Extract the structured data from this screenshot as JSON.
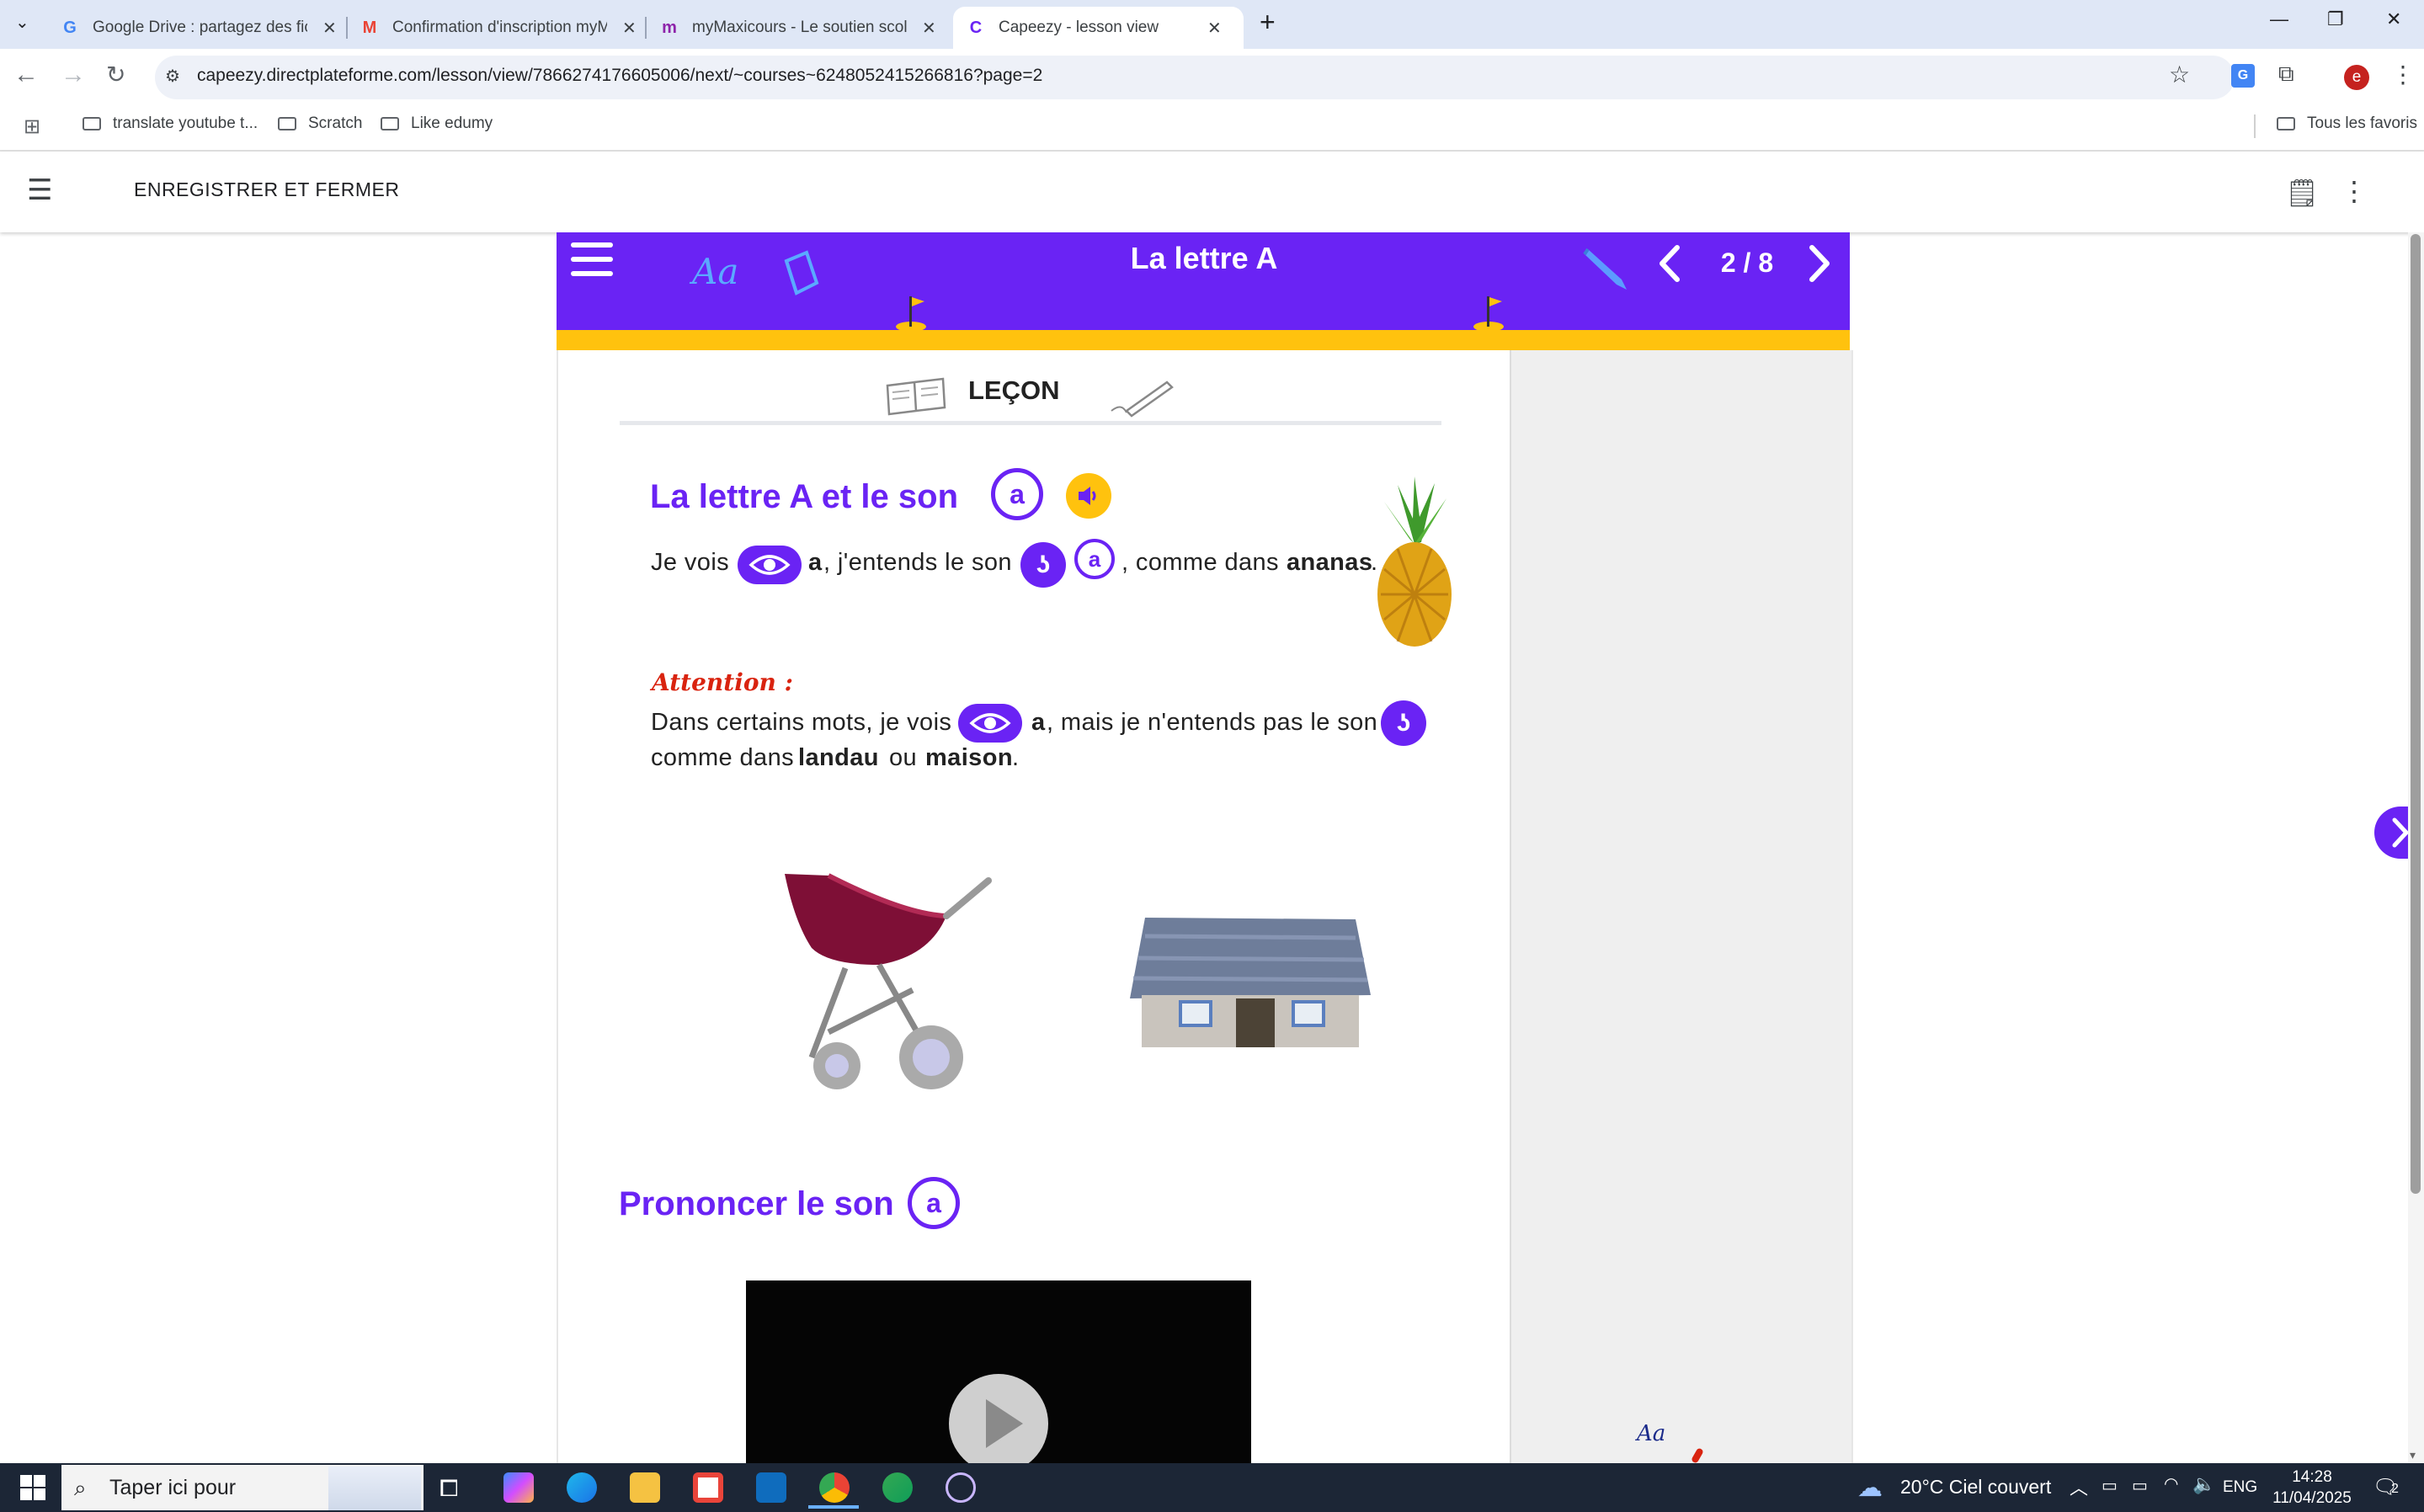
{
  "browser": {
    "tabs": [
      {
        "title": "Google Drive : partagez des fich",
        "icon": "google-icon"
      },
      {
        "title": "Confirmation d'inscription myM",
        "icon": "gmail-icon"
      },
      {
        "title": "myMaxicours - Le soutien scola",
        "icon": "maxicours-icon"
      },
      {
        "title": "Capeezy - lesson view",
        "icon": "capeezy-icon",
        "active": true
      }
    ],
    "url": "capeezy.directplateforme.com/lesson/view/7866274176605006/next/~courses~6248052415266816?page=2",
    "bookmarks": [
      "translate youtube t...",
      "Scratch",
      "Like edumy"
    ],
    "all_bookmarks": "Tous les favoris",
    "profile_initial": "e"
  },
  "app": {
    "save_close": "ENREGISTRER ET FERMER"
  },
  "lesson": {
    "title": "La lettre A",
    "page_indicator": "2 / 8",
    "aa_label": "Aa",
    "section_label": "LEÇON",
    "heading1": "La lettre A et le son",
    "sound_letter": "a",
    "line1": {
      "p1": "Je vois",
      "p2": "a",
      "p3": ", j'entends le son",
      "p4": ", comme dans",
      "p5": "ananas",
      "p6": "."
    },
    "attention": "Attention :",
    "line2": {
      "p1": "Dans certains mots, je vois",
      "p2": "a",
      "p3": ", mais je n'entends pas le son"
    },
    "line3": {
      "p1": "comme dans",
      "p2": "landau",
      "p3": "ou",
      "p4": "maison",
      "p5": "."
    },
    "heading2": "Prononcer le son",
    "side_aa": "Aa"
  },
  "taskbar": {
    "search_placeholder": "Taper ici pour",
    "weather": "20°C  Ciel couvert",
    "lang": "ENG",
    "time": "14:28",
    "date": "11/04/2025",
    "notifications": "2"
  },
  "colors": {
    "brand_purple": "#6a23f4",
    "banner_yellow": "#ffc20e",
    "attention_red": "#d9230f"
  }
}
